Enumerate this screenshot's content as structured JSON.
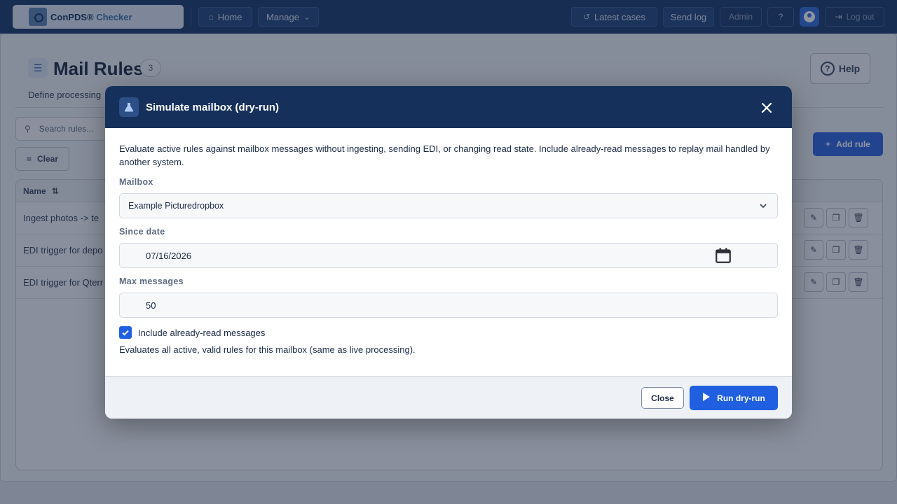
{
  "header": {
    "brand_name": "ConPDS",
    "brand_sub": "Checker",
    "nav": {
      "home": "Home",
      "manage": "Manage",
      "latest_cases": "Latest cases",
      "send_log": "Send log",
      "admin": "Admin",
      "logout": "Log out"
    }
  },
  "page": {
    "title": "Mail Rules",
    "count": "3",
    "help_label": "Help",
    "description": "Define processing",
    "search_placeholder": "Search rules...",
    "clear_label": "Clear",
    "add_rule_label": "Add rule",
    "table": {
      "name_header": "Name",
      "rows": [
        {
          "name": "Ingest photos -> te"
        },
        {
          "name": "EDI trigger for depo"
        },
        {
          "name": "EDI trigger for Qterr"
        }
      ]
    }
  },
  "modal": {
    "title": "Simulate mailbox (dry-run)",
    "intro": "Evaluate active rules against mailbox messages without ingesting, sending EDI, or changing read state. Include already-read messages to replay mail handled by another system.",
    "mailbox_label": "Mailbox",
    "mailbox_value": "Example Picturedropbox",
    "since_label": "Since date",
    "since_value": "07/16/2026",
    "max_label": "Max messages",
    "max_value": "50",
    "include_read_label": "Include already-read messages",
    "include_read_checked": true,
    "hint": "Evaluates all active, valid rules for this mailbox (same as live processing).",
    "close_label": "Close",
    "run_label": "Run dry-run"
  },
  "colors": {
    "header_bg": "#1c3a6b",
    "modal_header_bg": "#16305c",
    "primary": "#1f5fe0"
  }
}
